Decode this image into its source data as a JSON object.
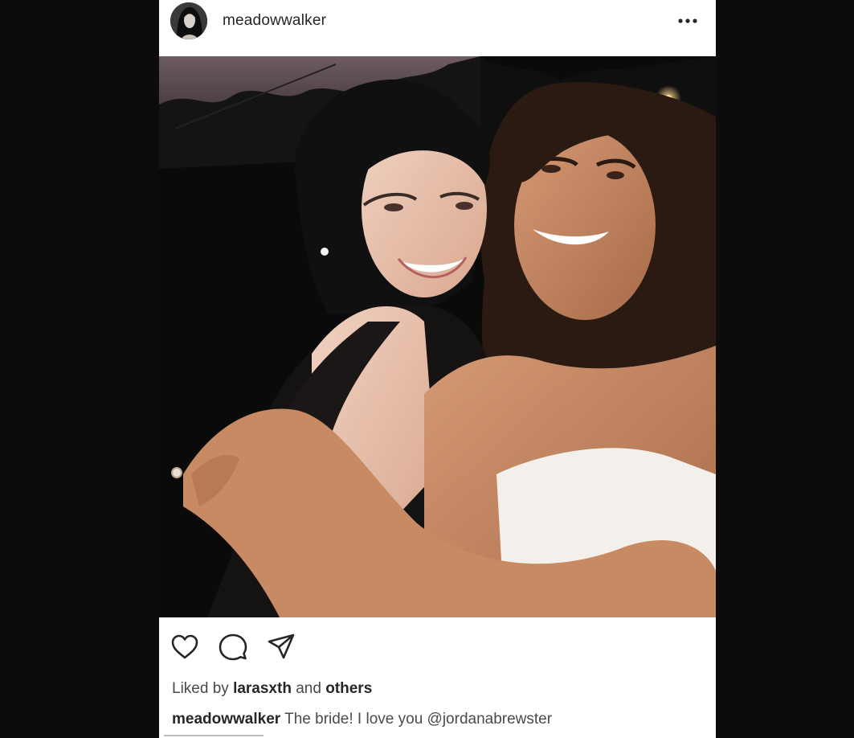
{
  "post": {
    "username": "meadowwalker",
    "more_icon": "more-horizontal-icon",
    "actions": {
      "like_icon": "heart-icon",
      "comment_icon": "comment-bubble-icon",
      "share_icon": "paper-plane-icon"
    },
    "likes": {
      "prefix": "Liked by",
      "user": "larasxth",
      "joiner": "and",
      "others": "others"
    },
    "caption": {
      "user": "meadowwalker",
      "text": "The bride! I love you",
      "mention": "@jordanabrewster"
    }
  }
}
